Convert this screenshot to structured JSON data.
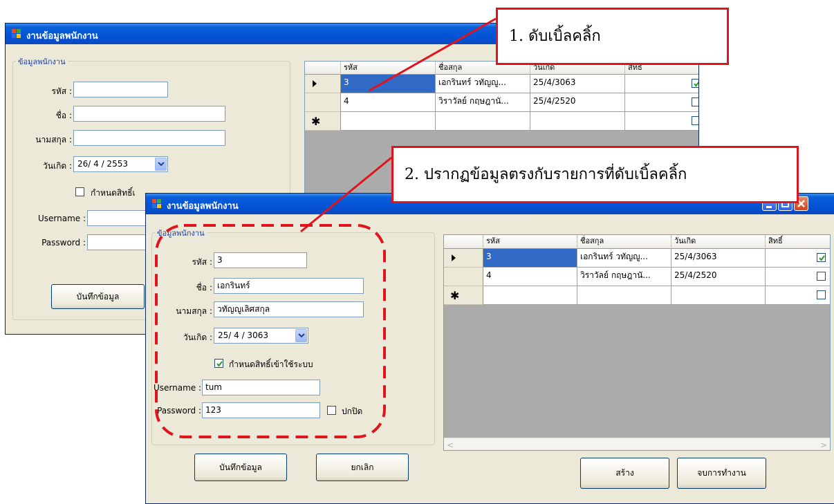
{
  "window_back": {
    "title": "งานข้อมูลพนักงาน",
    "group_title": "ข้อมูลพนักงาน",
    "fields": {
      "id_label": "รหัส :",
      "id_value": "",
      "name_label": "ชื่อ :",
      "name_value": "",
      "surname_label": "นามสกุล :",
      "surname_value": "",
      "birth_label": "วันเกิด :",
      "birth_value": "26/ 4 / 2553",
      "rights_checkbox_label": "กำหนดสิทธิ์เ",
      "rights_checked": false,
      "username_label": "Username :",
      "username_value": "",
      "password_label": "Password :",
      "password_value": ""
    },
    "save_button": "บันทึกข้อมูล",
    "grid": {
      "columns": [
        "รหัส",
        "ชื่อสกุล",
        "วันเกิด",
        "สิทธิ์"
      ],
      "rows": [
        {
          "id": "3",
          "name": "เอกรินทร์ วทัญญู...",
          "birth": "25/4/3063",
          "right": true,
          "current": true
        },
        {
          "id": "4",
          "name": "วิราวัลย์ กฤษฎานั...",
          "birth": "25/4/2520",
          "right": false,
          "current": false
        }
      ]
    }
  },
  "window_front": {
    "title": "งานข้อมูลพนักงาน",
    "group_title": "ข้อมูลพนักงาน",
    "fields": {
      "id_label": "รหัส :",
      "id_value": "3",
      "name_label": "ชื่อ :",
      "name_value": "เอกรินทร์",
      "surname_label": "นามสกุล :",
      "surname_value": "วทัญญูเลิศสกุล",
      "birth_label": "วันเกิด :",
      "birth_value": "25/ 4 / 3063",
      "rights_checkbox_label": "กำหนดสิทธิ์เข้าใช้ระบบ",
      "rights_checked": true,
      "username_label": "Username :",
      "username_value": "tum",
      "password_label": "Password :",
      "password_value": "123",
      "hide_checkbox_label": "ปกปิด",
      "hide_checked": false
    },
    "save_button": "บันทึกข้อมูล",
    "cancel_button": "ยกเลิก",
    "create_button": "สร้าง",
    "exit_button": "จบการทำงาน",
    "grid": {
      "columns": [
        "รหัส",
        "ชื่อสกุล",
        "วันเกิด",
        "สิทธิ์"
      ],
      "rows": [
        {
          "id": "3",
          "name": "เอกรินทร์ วทัญญู...",
          "birth": "25/4/3063",
          "right": true,
          "current": true
        },
        {
          "id": "4",
          "name": "วิราวัลย์ กฤษฎานั...",
          "birth": "25/4/2520",
          "right": false,
          "current": false
        }
      ]
    }
  },
  "annotations": {
    "callout_1": "1. ดับเบิ้ลคลิ้ก",
    "callout_2": "2. ปรากฏข้อมูลตรงกับรายการที่ดับเบิ้ลคลิ้ก"
  },
  "colors": {
    "titlebar": "#0453d6",
    "annotation_red": "#e0141c",
    "selection": "#316ac5",
    "window_bg": "#ece9d8"
  }
}
